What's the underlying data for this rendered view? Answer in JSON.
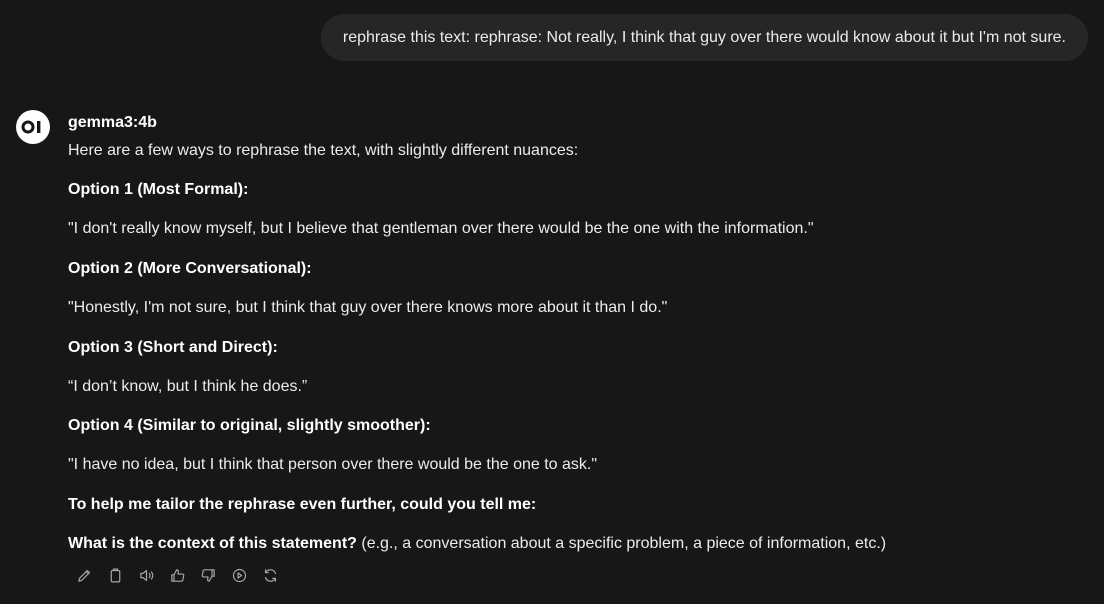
{
  "user_message": "rephrase this text: rephrase: Not really, I think that guy over there would know about it but I'm not sure.",
  "assistant": {
    "avatar_text": "OI",
    "model_name": "gemma3:4b",
    "intro": "Here are a few ways to rephrase the text, with slightly different nuances:",
    "options": [
      {
        "heading": "Option 1 (Most Formal):",
        "text": "\"I don't really know myself, but I believe that gentleman over there would be the one with the information.\""
      },
      {
        "heading": "Option 2 (More Conversational):",
        "text": "\"Honestly, I'm not sure, but I think that guy over there knows more about it than I do.\""
      },
      {
        "heading": "Option 3 (Short and Direct):",
        "text": "“I don’t know, but I think he does.”"
      },
      {
        "heading": "Option 4 (Similar to original, slightly smoother):",
        "text": "\"I have no idea, but I think that person over there would be the one to ask.\""
      }
    ],
    "followup_heading": "To help me tailor the rephrase even further, could you tell me:",
    "question_bold": "What is the context of this statement?",
    "question_rest": " (e.g., a conversation about a specific problem, a piece of information, etc.)"
  },
  "action_icons": [
    "edit-icon",
    "copy-icon",
    "read-aloud-icon",
    "thumbs-up-icon",
    "thumbs-down-icon",
    "continue-icon",
    "regenerate-icon"
  ]
}
